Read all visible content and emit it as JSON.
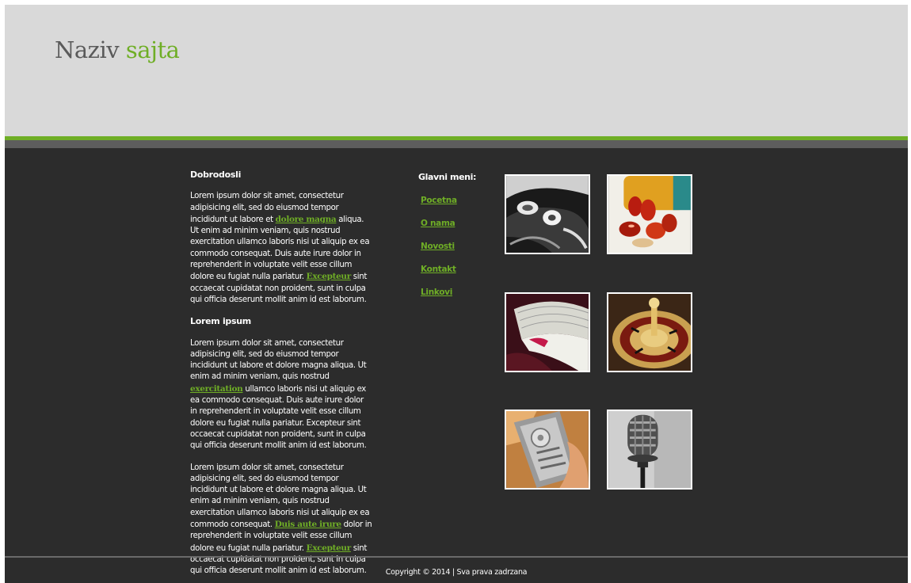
{
  "header": {
    "title_part1": "Naziv",
    "title_part2": "sajta"
  },
  "content": {
    "heading1": "Dobrodosli",
    "p1": {
      "t1": "Lorem ipsum dolor sit amet, consectetur adipisicing elit, sed do eiusmod tempor incididunt ut labore et ",
      "link1": "dolore magna",
      "t2": " aliqua. Ut enim ad minim veniam, quis nostrud exercitation ullamco laboris nisi ut aliquip ex ea commodo consequat. Duis aute irure dolor in reprehenderit in voluptate velit esse cillum dolore eu fugiat nulla pariatur. ",
      "link2": "Excepteur",
      "t3": " sint occaecat cupidatat non proident, sunt in culpa qui officia deserunt mollit anim id est laborum."
    },
    "heading2": "Lorem ipsum",
    "p2": {
      "t1": "Lorem ipsum dolor sit amet, consectetur adipisicing elit, sed do eiusmod tempor incididunt ut labore et dolore magna aliqua. Ut enim ad minim veniam, quis nostrud ",
      "link1": "exercitation",
      "t2": " ullamco laboris nisi ut aliquip ex ea commodo consequat. Duis aute irure dolor in reprehenderit in voluptate velit esse cillum dolore eu fugiat nulla pariatur. Excepteur sint occaecat cupidatat non proident, sunt in culpa qui officia deserunt mollit anim id est laborum."
    },
    "p3": {
      "t1": "Lorem ipsum dolor sit amet, consectetur adipisicing elit, sed do eiusmod tempor incididunt ut labore et dolore magna aliqua. Ut enim ad minim veniam, quis nostrud exercitation ullamco laboris nisi ut aliquip ex ea commodo consequat. ",
      "link1": "Duis aute irure",
      "t2": " dolor in reprehenderit in voluptate velit esse cillum dolore eu fugiat nulla pariatur. ",
      "link2": "Excepteur",
      "t3": " sint occaecat cupidatat non proident, sunt in culpa qui officia deserunt mollit anim id est laborum."
    }
  },
  "menu": {
    "title": "Glavni meni:",
    "items": [
      "Pocetna",
      "O nama",
      "Novosti",
      "Kontakt",
      "Linkovi"
    ]
  },
  "gallery": {
    "icons": [
      "car-headlight-icon",
      "pills-icon",
      "open-book-icon",
      "roulette-icon",
      "mobile-phone-icon",
      "microphone-icon"
    ]
  },
  "footer": {
    "text": "Copyright © 2014 | Sva prava zadrzana"
  },
  "colors": {
    "accent": "#6fae26",
    "header_bg": "#d9d9d9",
    "body_bg": "#2c2c2c",
    "band": "#5d5d5d"
  }
}
